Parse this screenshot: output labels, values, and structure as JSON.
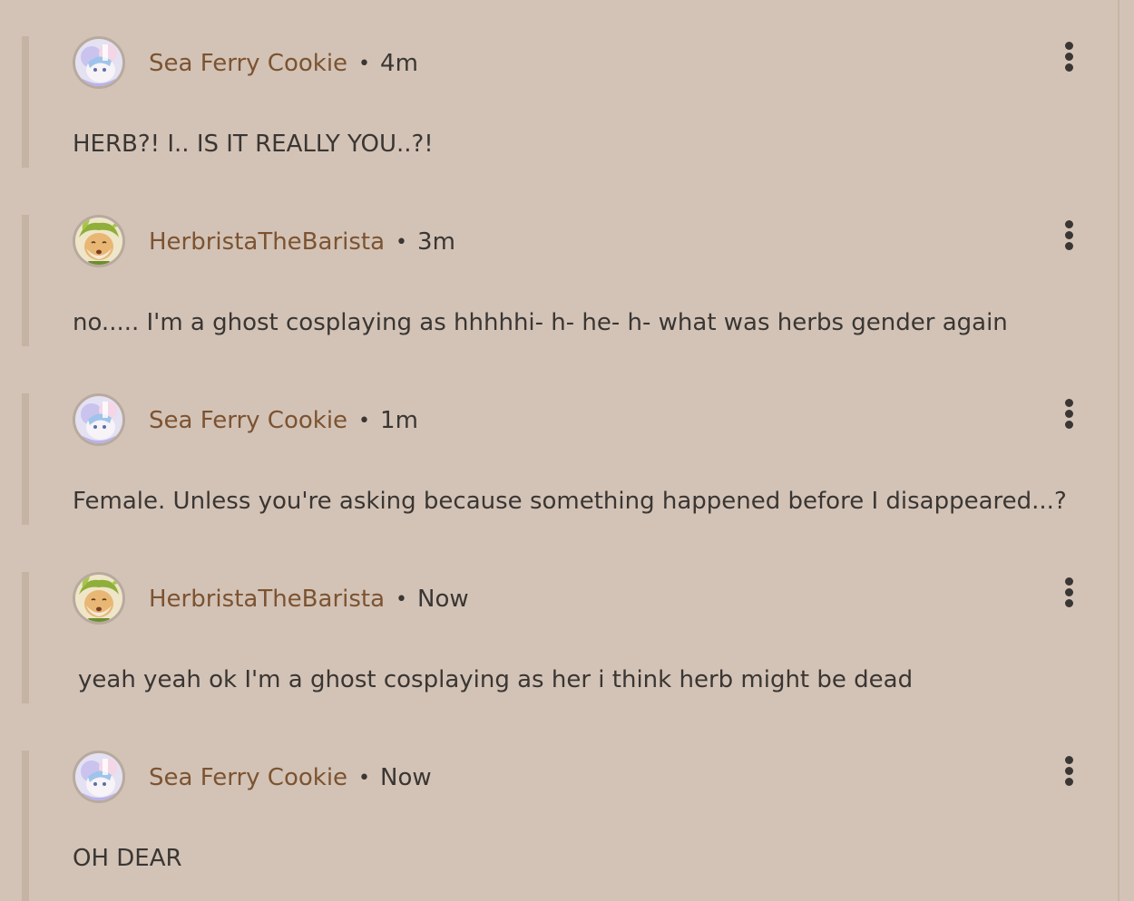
{
  "comments": [
    {
      "author": "Sea Ferry Cookie",
      "separator": "•",
      "time": "4m",
      "text": "HERB?! I.. IS IT REALLY YOU..?!",
      "avatar_icon": "sea-ferry-cookie-avatar-icon"
    },
    {
      "author": "HerbristaTheBarista",
      "separator": "•",
      "time": "3m",
      "text": "no..... I'm a ghost cosplaying as hhhhhi- h- he- h- what was herbs gender again",
      "avatar_icon": "herb-cookie-avatar-icon"
    },
    {
      "author": "Sea Ferry Cookie",
      "separator": "•",
      "time": "1m",
      "text": "Female. Unless you're asking because something happened before I disappeared...?",
      "avatar_icon": "sea-ferry-cookie-avatar-icon"
    },
    {
      "author": "HerbristaTheBarista",
      "separator": "•",
      "time": "Now",
      "text": "yeah yeah ok I'm a ghost cosplaying as her i think herb might be dead",
      "avatar_icon": "herb-cookie-avatar-icon"
    },
    {
      "author": "Sea Ferry Cookie",
      "separator": "•",
      "time": "Now",
      "text": "OH DEAR",
      "avatar_icon": "sea-ferry-cookie-avatar-icon"
    }
  ],
  "colors": {
    "background": "#d3c3b6",
    "author": "#7c5331",
    "text": "#3a3633",
    "thread_bar": "#c5b3a4"
  }
}
